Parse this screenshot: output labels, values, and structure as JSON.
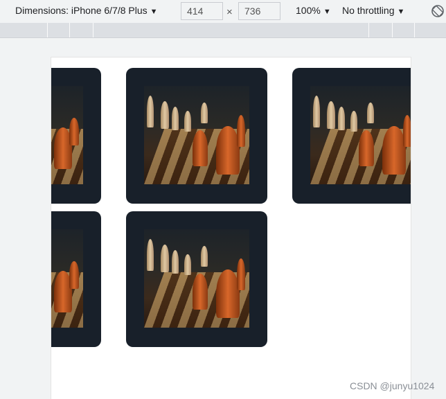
{
  "toolbar": {
    "dimensions_label": "Dimensions: iPhone 6/7/8 Plus",
    "width_value": "414",
    "height_value": "736",
    "times_symbol": "×",
    "zoom_label": "100%",
    "throttling_label": "No throttling",
    "dropdown_arrow": "▼",
    "rotate_icon": "rotate-icon"
  },
  "page": {
    "cards": [
      {
        "image": "chess-pieces-photo"
      },
      {
        "image": "chess-pieces-photo"
      },
      {
        "image": "chess-pieces-photo"
      },
      {
        "image": "chess-pieces-photo"
      },
      {
        "image": "chess-pieces-photo"
      }
    ]
  },
  "watermark": "CSDN @junyu1024",
  "colors": {
    "card_background": "#18202a",
    "toolbar_background": "#f1f3f4",
    "viewport_background": "#ffffff"
  }
}
